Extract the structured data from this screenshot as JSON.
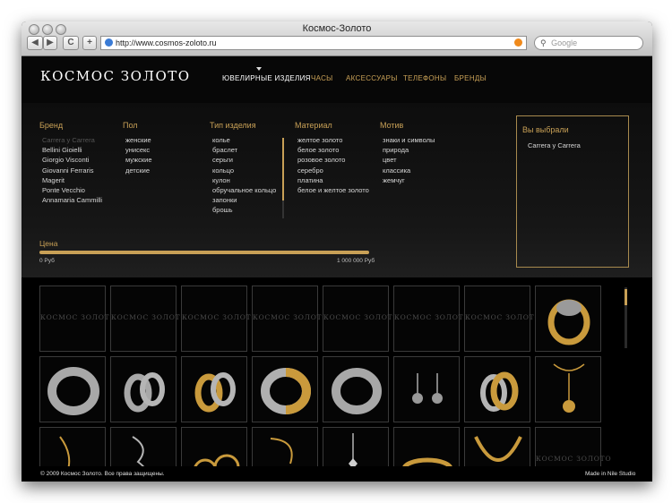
{
  "window": {
    "title": "Космос-Золото"
  },
  "toolbar": {
    "url": "http://www.cosmos-zoloto.ru",
    "search_placeholder": "Google",
    "reload_label": "C",
    "add_label": "+"
  },
  "site": {
    "logo": "КОСМОС ЗОЛОТО"
  },
  "nav": {
    "items": [
      {
        "label": "ЮВЕЛИРНЫЕ ИЗДЕЛИЯ",
        "active": true
      },
      {
        "label": "ЧАСЫ"
      },
      {
        "label": "АКСЕССУАРЫ"
      },
      {
        "label": "ТЕЛЕФОНЫ"
      },
      {
        "label": "БРЕНДЫ"
      }
    ]
  },
  "filters": {
    "brand": {
      "heading": "Бренд",
      "items": [
        "Carrera y Carrera",
        "Bellini Gioielli",
        "Giorgio Visconti",
        "Giovanni Ferraris",
        "Magerit",
        "Ponte Vecchio",
        "Annamaria Cammilli"
      ]
    },
    "gender": {
      "heading": "Пол",
      "items": [
        "женские",
        "унисекс",
        "мужские",
        "детские"
      ]
    },
    "type": {
      "heading": "Тип изделия",
      "items": [
        "колье",
        "браслет",
        "серьги",
        "кольцо",
        "кулон",
        "обручальное кольцо",
        "запонки",
        "брошь"
      ]
    },
    "material": {
      "heading": "Материал",
      "items": [
        "желтое золото",
        "белое золото",
        "розовое золото",
        "серебро",
        "платина",
        "белое и желтое золото"
      ]
    },
    "motif": {
      "heading": "Мотив",
      "items": [
        "знаки и символы",
        "природа",
        "цвет",
        "классика",
        "жемчуг"
      ]
    }
  },
  "selected": {
    "heading": "Вы выбрали",
    "items": [
      "Carrera y Carrera"
    ]
  },
  "price": {
    "label": "Цена",
    "min": "0 Руб",
    "max": "1 000 000 Руб"
  },
  "grid": {
    "placeholder_text": "КОСМОС ЗОЛОТО"
  },
  "footer": {
    "copyright": "© 2009 Космос Золото. Все права защищены.",
    "credit": "Made in Nile Studio"
  }
}
